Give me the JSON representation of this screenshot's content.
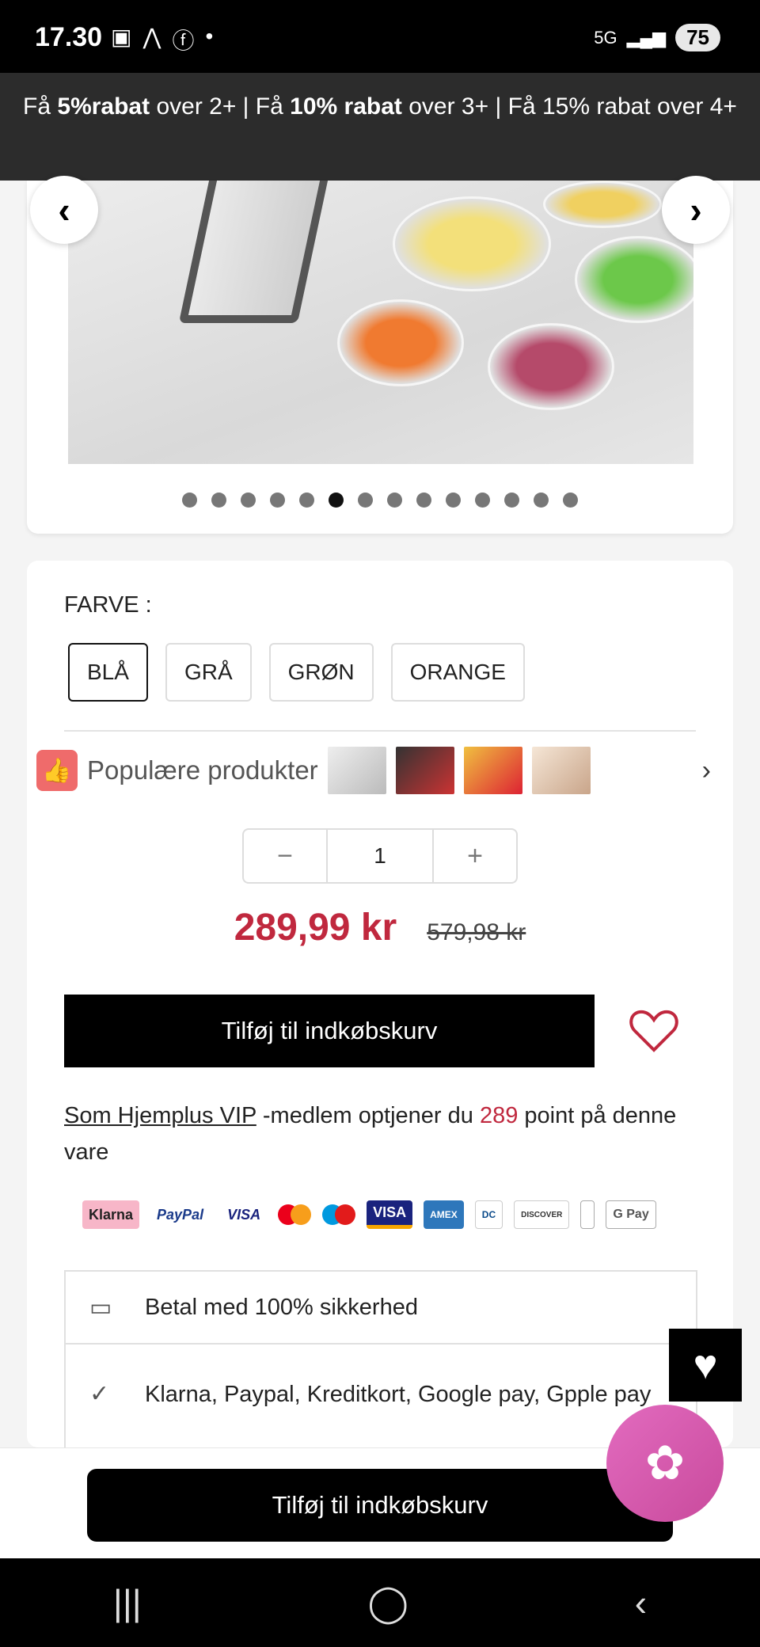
{
  "status_bar": {
    "time": "17.30",
    "network": "5G",
    "battery": "75"
  },
  "promo": {
    "part1_prefix": "Få ",
    "part1_bold": "5%rabat",
    "part1_suffix": " over 2+ | Få ",
    "part2_bold": "10% rabat",
    "part2_suffix": " over 3+ | Få 15% rabat over 4+"
  },
  "gallery": {
    "dot_count": 14,
    "active_index": 5
  },
  "product": {
    "color_label": "FARVE :",
    "color_options": [
      "BLÅ",
      "GRÅ",
      "GRØN",
      "ORANGE"
    ],
    "selected_color": "BLÅ",
    "popular_label": "Populære produkter",
    "quantity": "1",
    "price": "289,99 kr",
    "old_price": "579,98 kr",
    "add_to_cart": "Tilføj til indkøbskurv",
    "vip_link": "Som Hjemplus VIP",
    "vip_text_1": " -medlem optjener du ",
    "vip_points": "289",
    "vip_text_2": " point på denne vare"
  },
  "payments": [
    "Klarna",
    "PayPal",
    "VISA",
    "Mastercard",
    "maestro",
    "VISA Electron",
    "AMEX",
    "Diners Club",
    "DISCOVER",
    "Apple Pay",
    "G Pay"
  ],
  "features": [
    {
      "icon": "wallet-icon",
      "text": "Betal med 100% sikkerhed"
    },
    {
      "icon": "shield-check-icon",
      "text": "Klarna, Paypal, Kreditkort, Google pay, Gpple pay"
    }
  ],
  "bottom_bar": {
    "add_to_cart": "Tilføj til indkøbskurv"
  },
  "colors": {
    "accent_red": "#c0283e",
    "promo_bg": "#2c2c2c",
    "flower_pink": "#d95bb0"
  }
}
